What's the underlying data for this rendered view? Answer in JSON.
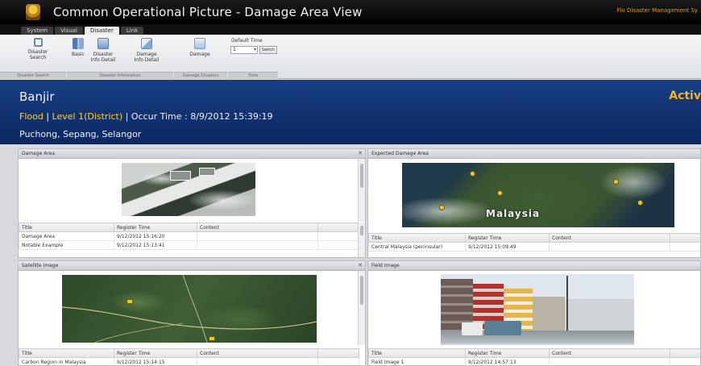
{
  "app": {
    "title": "Common Operational Picture - Damage Area View",
    "org": "Flo Disaster Management Sy"
  },
  "menu": {
    "tabs": [
      {
        "label": "System"
      },
      {
        "label": "Visual"
      },
      {
        "label": "Disaster"
      },
      {
        "label": "Link"
      }
    ]
  },
  "ribbon": {
    "buttons": [
      {
        "label": "Disaster Search",
        "icon": "search-icon"
      },
      {
        "label": "Basic",
        "icon": "grid-icon"
      },
      {
        "label": "Disaster Info Detail",
        "icon": "document-icon"
      },
      {
        "label": "Damage Info Detail",
        "icon": "chart-icon"
      },
      {
        "label": "Damage",
        "icon": "damage-icon"
      }
    ],
    "groups": [
      {
        "label": "Disaster Search"
      },
      {
        "label": "Disaster Information"
      },
      {
        "label": "Damage Situation"
      },
      {
        "label": "Time"
      }
    ],
    "default_time_label": "Default Time",
    "default_time_value": "1",
    "switch_label": "Switch"
  },
  "banner": {
    "title": "Banjir",
    "type": "Flood",
    "sep1": " | ",
    "level": "Level 1(District)",
    "sep2": " | Occur Time : ",
    "occur_time": "8/9/2012 15:39:19",
    "location": "Puchong, Sepang, Selangor",
    "status": "Activ"
  },
  "panels": {
    "damage_area": {
      "title": "Damage Area",
      "columns": [
        "Title",
        "Register Time",
        "Content"
      ],
      "rows": [
        {
          "title": "Damage Area",
          "time": "9/12/2012 15:16:20",
          "content": ""
        },
        {
          "title": "Notable Example",
          "time": "9/12/2012 15:13:41",
          "content": ""
        }
      ]
    },
    "expected_damage": {
      "title": "Expected Damage Area",
      "map_label": "Malaysia",
      "columns": [
        "Title",
        "Register Time",
        "Content"
      ],
      "rows": [
        {
          "title": "Central Malaysia (peninsular)",
          "time": "9/12/2012 15:09:49",
          "content": ""
        }
      ]
    },
    "satellite": {
      "title": "Satellite Image",
      "columns": [
        "Title",
        "Register Time",
        "Content"
      ],
      "rows": [
        {
          "title": "Carbon Region in Malaysia",
          "time": "9/12/2012 15:14:15",
          "content": ""
        }
      ]
    },
    "field": {
      "title": "Field Image",
      "columns": [
        "Title",
        "Register Time",
        "Content"
      ],
      "rows": [
        {
          "title": "Field Image 1",
          "time": "9/12/2012 14:57:13",
          "content": ""
        }
      ]
    }
  },
  "colors": {
    "banner_bg": "#173e84",
    "highlight": "#ffd12e",
    "status": "#f7b21e",
    "titlebar": "#000000"
  }
}
